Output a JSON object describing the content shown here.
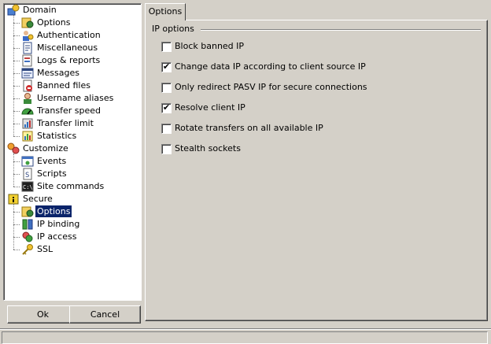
{
  "tree": {
    "groups": [
      {
        "label": "Domain",
        "icon": "domain-icon",
        "children": [
          {
            "label": "Options",
            "icon": "options-icon"
          },
          {
            "label": "Authentication",
            "icon": "users-icon"
          },
          {
            "label": "Miscellaneous",
            "icon": "document-icon"
          },
          {
            "label": "Logs & reports",
            "icon": "log-icon"
          },
          {
            "label": "Messages",
            "icon": "message-icon"
          },
          {
            "label": "Banned files",
            "icon": "banned-file-icon"
          },
          {
            "label": "Username aliases",
            "icon": "user-alias-icon"
          },
          {
            "label": "Transfer speed",
            "icon": "speedometer-icon"
          },
          {
            "label": "Transfer limit",
            "icon": "limit-icon"
          },
          {
            "label": "Statistics",
            "icon": "statistics-icon"
          }
        ]
      },
      {
        "label": "Customize",
        "icon": "customize-icon",
        "children": [
          {
            "label": "Events",
            "icon": "events-icon"
          },
          {
            "label": "Scripts",
            "icon": "script-icon"
          },
          {
            "label": "Site commands",
            "icon": "terminal-icon"
          }
        ]
      },
      {
        "label": "Secure",
        "icon": "lock-icon",
        "children": [
          {
            "label": "Options",
            "icon": "options-icon",
            "selected": true
          },
          {
            "label": "IP binding",
            "icon": "ip-binding-icon"
          },
          {
            "label": "IP access",
            "icon": "ip-access-icon"
          },
          {
            "label": "SSL",
            "icon": "key-icon"
          }
        ]
      }
    ]
  },
  "buttons": {
    "ok": "Ok",
    "cancel": "Cancel"
  },
  "tab": {
    "label": "Options"
  },
  "group": {
    "title": "IP options"
  },
  "options": [
    {
      "label": "Block banned IP",
      "checked": false
    },
    {
      "label": "Change data IP according to client source IP",
      "checked": true
    },
    {
      "label": "Only redirect PASV IP for secure connections",
      "checked": false
    },
    {
      "label": "Resolve client IP",
      "checked": true
    },
    {
      "label": "Rotate transfers on all available IP",
      "checked": false
    },
    {
      "label": "Stealth sockets",
      "checked": false
    }
  ],
  "colors": {
    "selection": "#0a246a",
    "face": "#d4d0c8"
  }
}
